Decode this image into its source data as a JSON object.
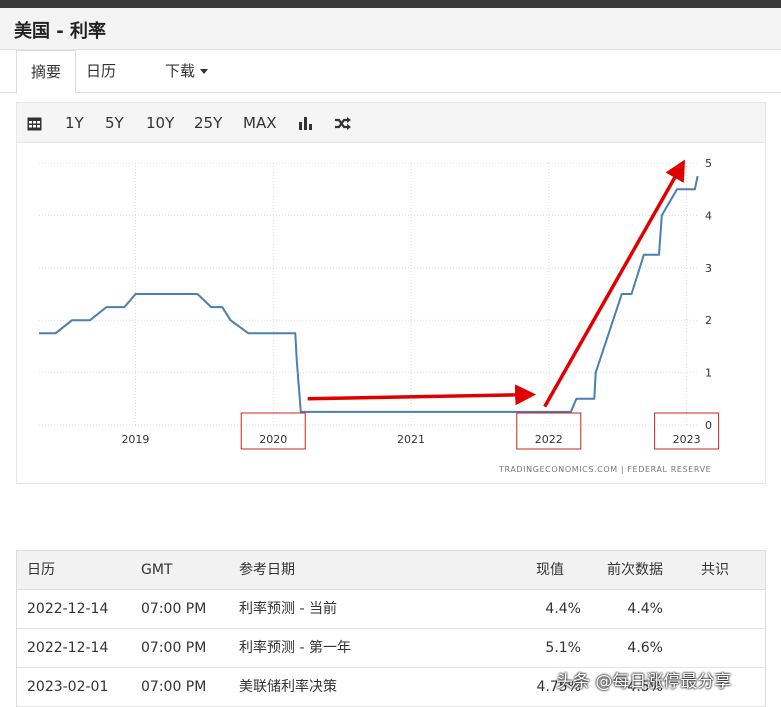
{
  "header": {
    "title": "美国 - 利率"
  },
  "tabs": [
    {
      "label": "摘要"
    },
    {
      "label": "日历"
    },
    {
      "label": "下载"
    }
  ],
  "toolbar": {
    "icons": [
      "calendar-icon",
      "bar-chart-icon",
      "shuffle-icon"
    ],
    "ranges": [
      "1Y",
      "5Y",
      "10Y",
      "25Y",
      "MAX"
    ]
  },
  "chart_data": {
    "type": "line",
    "x_tick_labels": [
      "2019",
      "2020",
      "2021",
      "2022",
      "2023"
    ],
    "y_tick_labels": [
      "0",
      "1",
      "2",
      "3",
      "4",
      "5"
    ],
    "ylim": [
      0,
      5
    ],
    "xlim": [
      2018.3,
      2023.09
    ],
    "grid": true,
    "source": "TRADINGECONOMICS.COM  |  FEDERAL RESERVE",
    "series": [
      {
        "color": "#4a7fb0",
        "points": [
          [
            2018.3,
            1.75
          ],
          [
            2018.42,
            1.75
          ],
          [
            2018.54,
            2.0
          ],
          [
            2018.67,
            2.0
          ],
          [
            2018.79,
            2.25
          ],
          [
            2018.92,
            2.25
          ],
          [
            2019.0,
            2.5
          ],
          [
            2019.12,
            2.5
          ],
          [
            2019.25,
            2.5
          ],
          [
            2019.45,
            2.5
          ],
          [
            2019.55,
            2.25
          ],
          [
            2019.63,
            2.25
          ],
          [
            2019.69,
            2.0
          ],
          [
            2019.82,
            1.75
          ],
          [
            2020.0,
            1.75
          ],
          [
            2020.16,
            1.75
          ],
          [
            2020.17,
            1.25
          ],
          [
            2020.2,
            0.25
          ],
          [
            2020.5,
            0.25
          ],
          [
            2021.0,
            0.25
          ],
          [
            2021.5,
            0.25
          ],
          [
            2022.16,
            0.25
          ],
          [
            2022.2,
            0.5
          ],
          [
            2022.33,
            0.5
          ],
          [
            2022.34,
            1.0
          ],
          [
            2022.53,
            2.5
          ],
          [
            2022.6,
            2.5
          ],
          [
            2022.69,
            3.25
          ],
          [
            2022.8,
            3.25
          ],
          [
            2022.82,
            4.0
          ],
          [
            2022.93,
            4.5
          ],
          [
            2023.06,
            4.5
          ],
          [
            2023.08,
            4.75
          ]
        ]
      }
    ],
    "annotations": [
      {
        "type": "arrow",
        "color": "#e00000",
        "from": [
          2020.25,
          0.5
        ],
        "to": [
          2021.87,
          0.58
        ]
      },
      {
        "type": "arrow",
        "color": "#e00000",
        "from": [
          2021.97,
          0.35
        ],
        "to": [
          2022.97,
          4.98
        ]
      },
      {
        "type": "box",
        "color": "#cc2222",
        "around_label": "2020"
      },
      {
        "type": "box",
        "color": "#cc2222",
        "around_label": "2022"
      },
      {
        "type": "box",
        "color": "#cc2222",
        "around_label": "2023"
      }
    ]
  },
  "table": {
    "headers": [
      "日历",
      "GMT",
      "参考日期",
      "现值",
      "前次数据",
      "共识"
    ],
    "rows": [
      [
        "2022-12-14",
        "07:00 PM",
        "利率预测 - 当前",
        "4.4%",
        "4.4%",
        ""
      ],
      [
        "2022-12-14",
        "07:00 PM",
        "利率预测 - 第一年",
        "5.1%",
        "4.6%",
        ""
      ],
      [
        "2023-02-01",
        "07:00 PM",
        "美联储利率决策",
        "4.75%",
        "4.5%",
        ""
      ]
    ]
  },
  "watermark": "头条 @每日涨停最分享"
}
